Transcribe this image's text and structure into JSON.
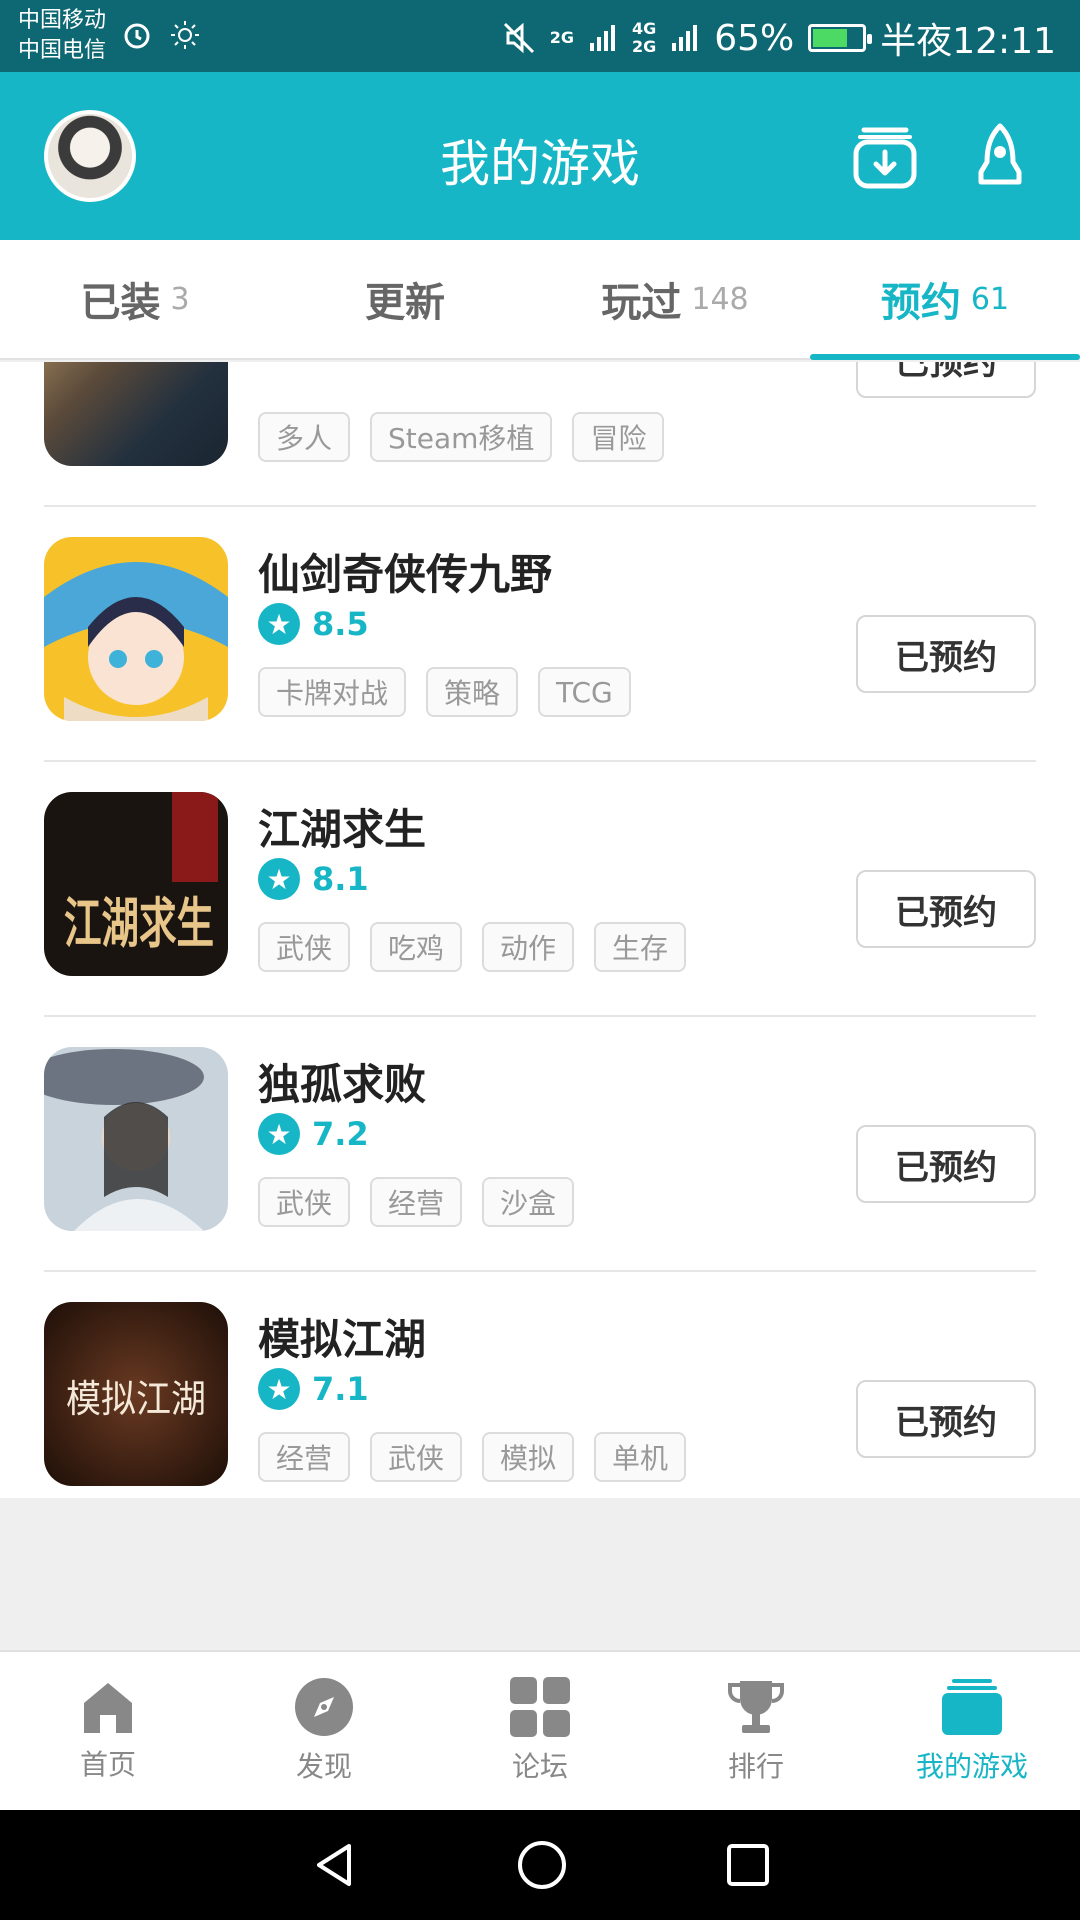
{
  "status_bar": {
    "carrier1": "中国移动",
    "carrier2": "中国电信",
    "net1": "2G",
    "net2": "4G",
    "net3": "2G",
    "battery": "65%",
    "time": "半夜12:11"
  },
  "header": {
    "title": "我的游戏"
  },
  "tabs": [
    {
      "label": "已装",
      "count": "3"
    },
    {
      "label": "更新",
      "count": ""
    },
    {
      "label": "玩过",
      "count": "148"
    },
    {
      "label": "预约",
      "count": "61"
    }
  ],
  "games": [
    {
      "name": "",
      "score": "",
      "tags": [
        "多人",
        "Steam移植",
        "冒险"
      ],
      "button": "已预约"
    },
    {
      "name": "仙剑奇侠传九野",
      "score": "8.5",
      "tags": [
        "卡牌对战",
        "策略",
        "TCG"
      ],
      "button": "已预约"
    },
    {
      "name": "江湖求生",
      "score": "8.1",
      "tags": [
        "武侠",
        "吃鸡",
        "动作",
        "生存"
      ],
      "button": "已预约"
    },
    {
      "name": "独孤求败",
      "score": "7.2",
      "tags": [
        "武侠",
        "经营",
        "沙盒"
      ],
      "button": "已预约"
    },
    {
      "name": "模拟江湖",
      "score": "7.1",
      "tags": [
        "经营",
        "武侠",
        "模拟",
        "单机"
      ],
      "button": "已预约"
    }
  ],
  "icon_texts": {
    "jianghu": "江湖求生",
    "moni": "模拟江湖"
  },
  "bottom_nav": [
    {
      "label": "首页",
      "icon": "home-icon"
    },
    {
      "label": "发现",
      "icon": "compass-icon"
    },
    {
      "label": "论坛",
      "icon": "grid-icon"
    },
    {
      "label": "排行",
      "icon": "trophy-icon"
    },
    {
      "label": "我的游戏",
      "icon": "stack-icon"
    }
  ],
  "colors": {
    "accent": "#17b6c6",
    "status_bar": "#0e6873"
  }
}
